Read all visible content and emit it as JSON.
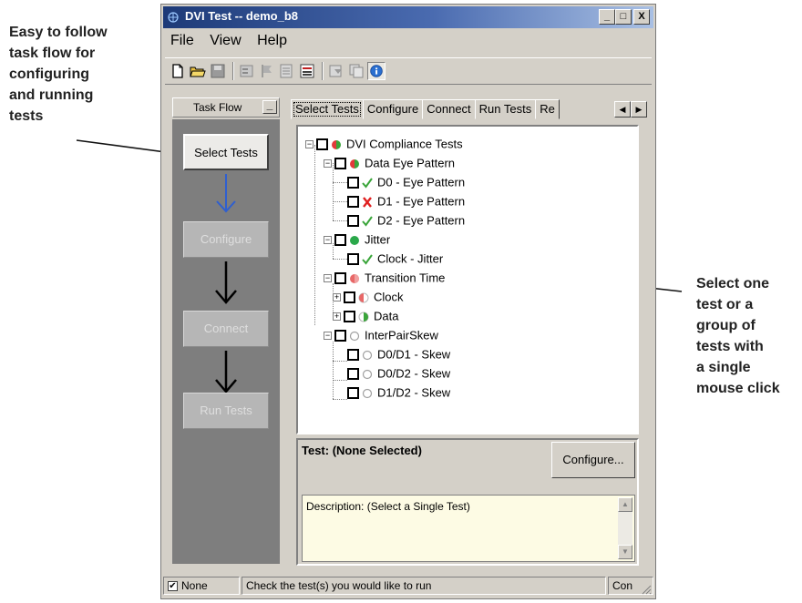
{
  "annotations": {
    "left": "Easy to follow\ntask flow for\nconfiguring\nand running\ntests",
    "right": "Select one\ntest or a\ngroup of\ntests with\na single\nmouse click"
  },
  "window": {
    "title": "DVI Test -- demo_b8",
    "buttons": {
      "minimize": "_",
      "maximize": "□",
      "close": "X"
    }
  },
  "menu": [
    "File",
    "View",
    "Help"
  ],
  "toolbar": {
    "icons": [
      "new-document-icon",
      "open-folder-icon",
      "save-disk-icon",
      "properties-icon",
      "flag-icon",
      "report-icon",
      "results-icon",
      "filter-icon",
      "copy-icon",
      "info-icon"
    ]
  },
  "task_flow": {
    "header": "Task Flow",
    "minimize": "_",
    "steps": [
      {
        "label": "Select Tests",
        "state": "active"
      },
      {
        "label": "Configure",
        "state": "disabled"
      },
      {
        "label": "Connect",
        "state": "disabled"
      },
      {
        "label": "Run Tests",
        "state": "disabled"
      }
    ]
  },
  "tabs": [
    "Select Tests",
    "Configure",
    "Connect",
    "Run Tests",
    "Re"
  ],
  "tree": [
    {
      "label": "DVI Compliance Tests",
      "status": "half-red-green",
      "expander": "−"
    },
    {
      "label": "Data Eye Pattern",
      "status": "half-red-green",
      "expander": "−"
    },
    {
      "label": "D0 - Eye Pattern",
      "status": "pass-check"
    },
    {
      "label": "D1 - Eye Pattern",
      "status": "fail-x"
    },
    {
      "label": "D2 - Eye Pattern",
      "status": "pass-check"
    },
    {
      "label": "Jitter",
      "status": "green-dot",
      "expander": "−"
    },
    {
      "label": "Clock - Jitter",
      "status": "pass-check"
    },
    {
      "label": "Transition Time",
      "status": "red-dot-pink",
      "expander": "−"
    },
    {
      "label": "Clock",
      "status": "half-red-gray",
      "expander": "+"
    },
    {
      "label": "Data",
      "status": "half-green-gray",
      "expander": "+"
    },
    {
      "label": "InterPairSkew",
      "status": "empty-circle",
      "expander": "−"
    },
    {
      "label": "D0/D1 - Skew",
      "status": "empty-circle"
    },
    {
      "label": "D0/D2 - Skew",
      "status": "empty-circle"
    },
    {
      "label": "D1/D2 - Skew",
      "status": "empty-circle"
    }
  ],
  "detail": {
    "test_label": "Test: (None Selected)",
    "configure_button": "Configure...",
    "description": "Description: (Select a Single Test)"
  },
  "statusbar": {
    "check_label": "None",
    "message": "Check the test(s) you would like to run",
    "connection": "Con"
  },
  "colors": {
    "title_gradient_start": "#1d3a78",
    "task_panel_bg": "#7e7e7e",
    "flow_arrow_active": "#2f5fd0",
    "pass": "#3aa53a",
    "fail": "#e02020",
    "description_bg": "#fdfbe4"
  }
}
